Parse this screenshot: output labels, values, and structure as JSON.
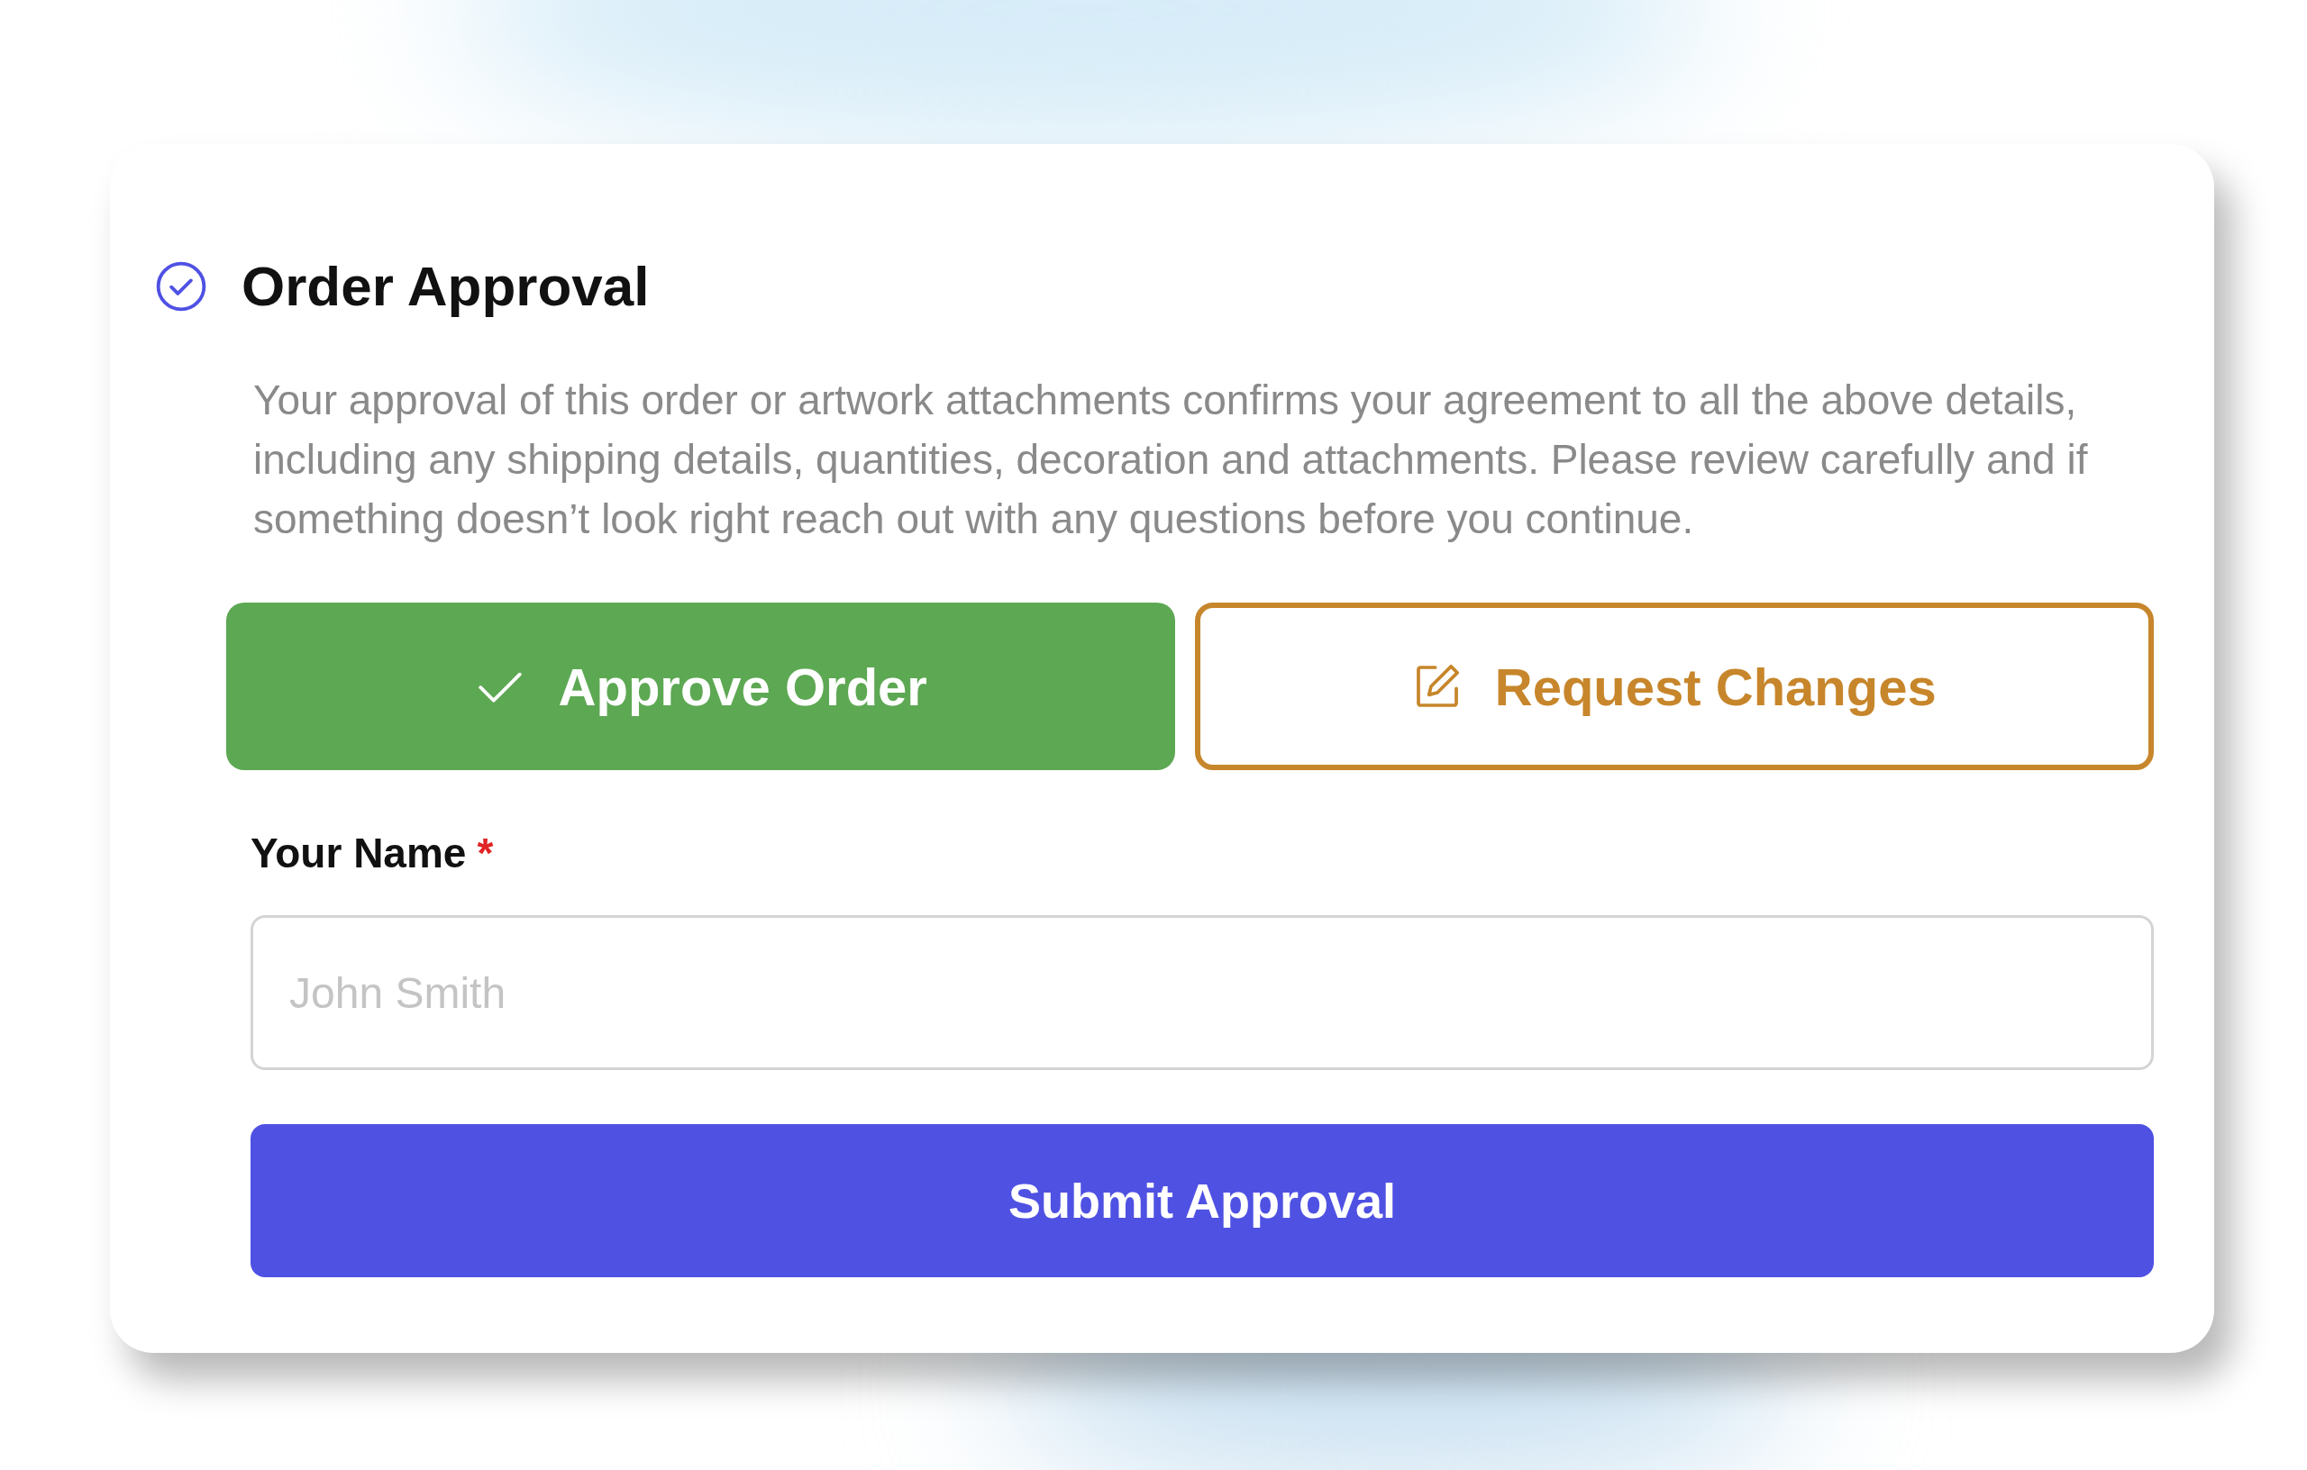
{
  "card": {
    "title": "Order Approval",
    "description": "Your approval of this order or artwork attachments confirms your agreement to all the above details, including any shipping details, quantities, decoration and attachments. Please review carefully and if something doesn’t look right reach out with any questions before you continue.",
    "actions": [
      {
        "kind": "approve",
        "label": "Approve Order"
      },
      {
        "kind": "request",
        "label": "Request Changes"
      }
    ],
    "name_field": {
      "label": "Your Name",
      "required_mark": "*",
      "placeholder": "John Smith"
    },
    "submit": {
      "label": "Submit Approval"
    }
  }
}
